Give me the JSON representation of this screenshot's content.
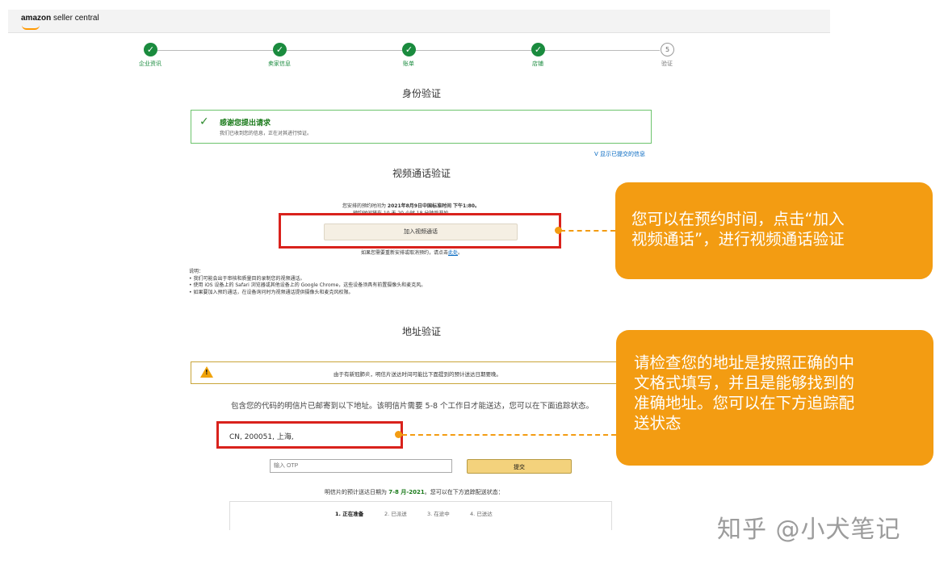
{
  "header": {
    "logo_brand": "amazon",
    "logo_suffix": "seller central"
  },
  "steps": [
    {
      "label": "企业资讯",
      "state": "done",
      "icon": "check-icon"
    },
    {
      "label": "卖家信息",
      "state": "done",
      "icon": "check-icon"
    },
    {
      "label": "账单",
      "state": "done",
      "icon": "check-icon"
    },
    {
      "label": "店铺",
      "state": "done",
      "icon": "check-icon"
    },
    {
      "label": "验证",
      "state": "todo",
      "number": "5"
    }
  ],
  "identity": {
    "title": "身份验证",
    "success_title": "感谢您提出请求",
    "success_text": "我们已收到您的信息，正在对其进行验证。",
    "show_submitted_link": "V 显示已提交的信息"
  },
  "video": {
    "title": "视频通话验证",
    "schedule_prefix": "您安排的预约时间为 ",
    "schedule_time": "2021年8月9日中国标准时间 下午1:80。",
    "countdown": "预约时间将在 10 天 20 小时 18 分钟后开始。",
    "join_button": "加入视频通话",
    "reschedule_prefix": "如果您需要重新安排或取消预约，请点击",
    "reschedule_link": "此处",
    "reschedule_suffix": "。",
    "notes_title": "说明：",
    "notes": [
      "我们可能会出于审核和质量目的录制您的视频通话。",
      "使用 iOS 设备上的 Safari 浏览器或其他设备上的 Google Chrome，这些设备须具有前置摄像头和麦克风。",
      "如果要加入预约通话，在设备询问时为视频通话提供摄像头和麦克风权限。"
    ]
  },
  "address": {
    "title": "地址验证",
    "warning": "由于有新冠肺炎，明信片送达时间可能比下面提到的预计送达日期要晚。",
    "mailed_text": "包含您的代码的明信片已邮寄到以下地址。该明信片需要 5-8 个工作日才能送达，您可以在下面追踪状态。",
    "address_value": "CN, 200051, 上海,",
    "otp_placeholder": "输入 OTP",
    "submit_button": "提交",
    "eta_prefix": "明信片的预计送达日期为 ",
    "eta_value": "7-8 月-2021",
    "eta_suffix": "。您可以在下方追踪配送状态：",
    "tracking": [
      {
        "label": "1. 正在准备",
        "active": true
      },
      {
        "label": "2. 已派送",
        "active": false
      },
      {
        "label": "3. 在途中",
        "active": false
      },
      {
        "label": "4. 已送达",
        "active": false
      }
    ]
  },
  "callouts": {
    "video": [
      "您可以在预约时间，点击“加入",
      "视频通话”，进行视频通话验证"
    ],
    "address": [
      "请检查您的地址是按照正确的中",
      "文格式填写，并且是能够找到的",
      "准确地址。您可以在下方追踪配",
      "送状态"
    ]
  },
  "watermark": "知乎 @小犬笔记",
  "colors": {
    "done_green": "#1a8b3e",
    "callout_orange": "#f39c12",
    "highlight_red": "#d9221c",
    "link_blue": "#0066c0"
  }
}
